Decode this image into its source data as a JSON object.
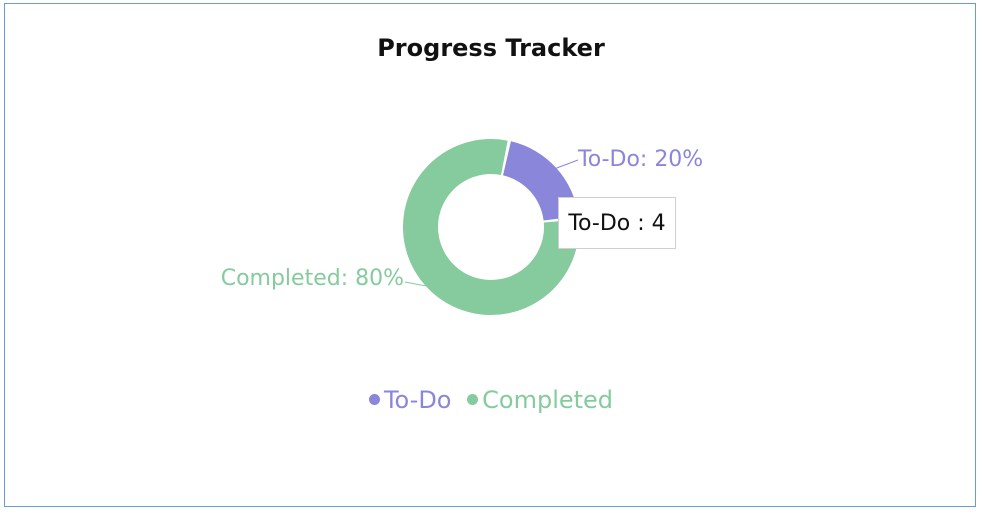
{
  "chart_data": {
    "type": "pie",
    "style": "donut",
    "title": "Progress Tracker",
    "categories": [
      "To-Do",
      "Completed"
    ],
    "values": [
      4,
      16
    ],
    "percent_labels": [
      "To-Do: 20%",
      "Completed: 80%"
    ],
    "colors": [
      "#8a86da",
      "#86cb9e"
    ],
    "legend": [
      "To-Do",
      "Completed"
    ],
    "legend_position": "bottom",
    "tooltip": "To-Do : 4"
  }
}
